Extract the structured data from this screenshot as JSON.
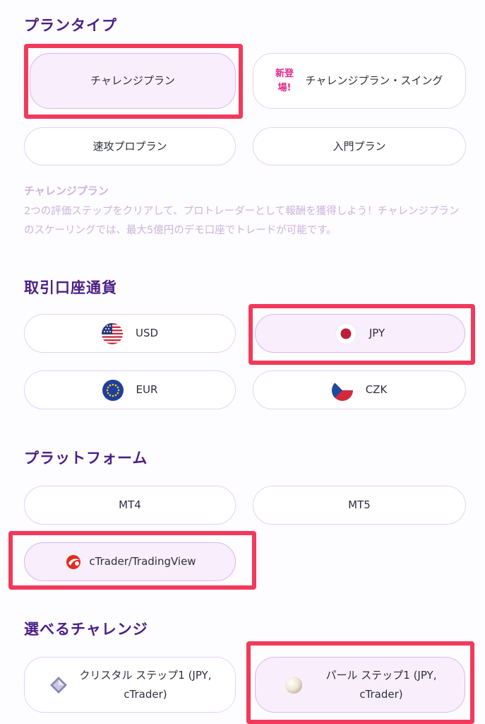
{
  "plan_type": {
    "heading": "プランタイプ",
    "options": [
      {
        "label": "チャレンジプラン"
      },
      {
        "badge": "新登場!",
        "label": "チャレンジプラン・スイング"
      },
      {
        "label": "速攻プロプラン"
      },
      {
        "label": "入門プラン"
      }
    ],
    "selected": "チャレンジプラン",
    "description_title": "チャレンジプラン",
    "description": "2つの評価ステップをクリアして、プロトレーダーとして報酬を獲得しよう！チャレンジプランのスケーリングでは、最大5億円のデモ口座でトレードが可能です。"
  },
  "currency": {
    "heading": "取引口座通貨",
    "options": [
      {
        "label": "USD",
        "icon": "us-flag-icon"
      },
      {
        "label": "JPY",
        "icon": "japan-flag-icon"
      },
      {
        "label": "EUR",
        "icon": "eu-flag-icon"
      },
      {
        "label": "CZK",
        "icon": "czech-flag-icon"
      }
    ],
    "selected": "JPY"
  },
  "platform": {
    "heading": "プラットフォーム",
    "options": [
      {
        "label": "MT4"
      },
      {
        "label": "MT5"
      },
      {
        "label": "cTrader/TradingView",
        "icon": "ctrader-logo-icon"
      }
    ],
    "selected": "cTrader/TradingView"
  },
  "challenge": {
    "heading": "選べるチャレンジ",
    "options": [
      {
        "label_line1": "クリスタル ステップ1 (JPY,",
        "label_line2": "cTrader)",
        "icon": "crystal-gem-icon"
      },
      {
        "label_line1": "パール ステップ1 (JPY,",
        "label_line2": "cTrader)",
        "icon": "pearl-icon"
      }
    ],
    "selected": "パール ステップ1 (JPY, cTrader)"
  },
  "colors": {
    "heading": "#4a1f86",
    "highlight": "#f2395c",
    "selected_bg": "#f8eefc",
    "new_badge": "#e02a8c"
  }
}
